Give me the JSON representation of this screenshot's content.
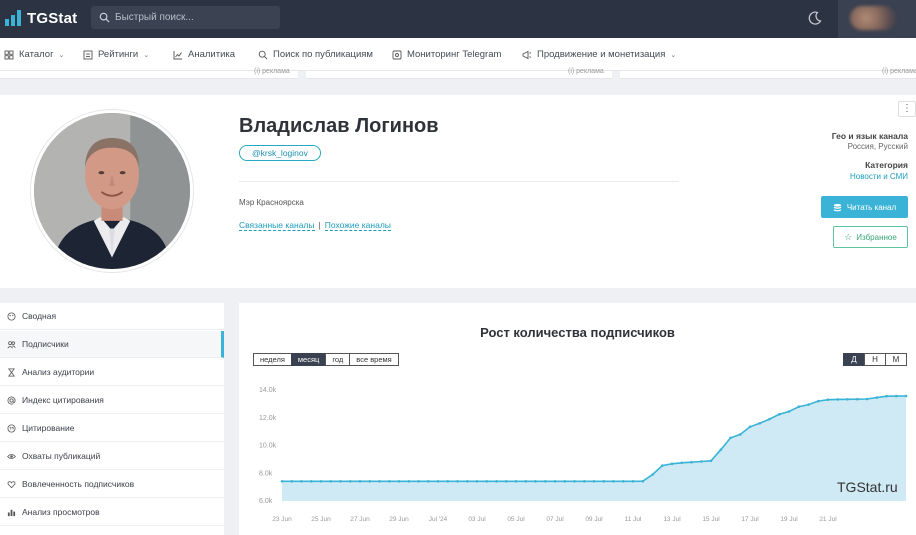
{
  "brand": {
    "name": "TGStat"
  },
  "search": {
    "placeholder": "Быстрый поиск..."
  },
  "menu": [
    {
      "label": "Каталог",
      "icon": "grid-icon",
      "dropdown": true
    },
    {
      "label": "Рейтинги",
      "icon": "list-icon",
      "dropdown": true
    },
    {
      "label": "Аналитика",
      "icon": "chart-line-icon",
      "dropdown": false
    },
    {
      "label": "Поиск по публикациям",
      "icon": "search-icon",
      "dropdown": false
    },
    {
      "label": "Мониторинг Telegram",
      "icon": "monitor-icon",
      "dropdown": false
    },
    {
      "label": "Продвижение и монетизация",
      "icon": "megaphone-icon",
      "dropdown": true
    }
  ],
  "strip": {
    "ad_label": "(i) реклама"
  },
  "profile": {
    "name": "Владислав Логинов",
    "handle": "@krsk_loginov",
    "description": "Мэр Красноярска",
    "related_link": "Связанные каналы",
    "similar_link": "Похожие каналы",
    "geo_title": "Гео и язык канала",
    "geo_value": "Россия, Русский",
    "category_title": "Категория",
    "category_value": "Новости и СМИ",
    "read_button": "Читать канал",
    "fav_button": "Избранное"
  },
  "sidebar": {
    "items": [
      {
        "label": "Сводная",
        "icon": "palette-icon",
        "active": false
      },
      {
        "label": "Подписчики",
        "icon": "users-icon",
        "active": true
      },
      {
        "label": "Анализ аудитории",
        "icon": "hourglass-icon",
        "active": false
      },
      {
        "label": "Индекс цитирования",
        "icon": "at-icon",
        "active": false
      },
      {
        "label": "Цитирование",
        "icon": "quote-icon",
        "active": false
      },
      {
        "label": "Охваты публикаций",
        "icon": "eye-icon",
        "active": false
      },
      {
        "label": "Вовлеченность подписчиков",
        "icon": "heart-icon",
        "active": false
      },
      {
        "label": "Анализ просмотров",
        "icon": "bar-chart-icon",
        "active": false
      }
    ]
  },
  "chart_panel": {
    "tabs": [
      "неделя",
      "месяц",
      "год",
      "все время"
    ],
    "selected_tab": "месяц",
    "period_tabs": [
      "Д",
      "Н",
      "М"
    ],
    "selected_period": "Д",
    "watermark": "TGStat.ru"
  },
  "chart_data": {
    "type": "area",
    "title": "Рост количества подписчиков",
    "y_ticks": [
      "6.0k",
      "8.0k",
      "10.0k",
      "12.0k",
      "14.0k"
    ],
    "ylim": [
      6000,
      14000
    ],
    "x_ticks": [
      "23 Jun",
      "25 Jun",
      "27 Jun",
      "29 Jun",
      "Jul '24",
      "03 Jul",
      "05 Jul",
      "07 Jul",
      "09 Jul",
      "11 Jul",
      "13 Jul",
      "15 Jul",
      "17 Jul",
      "19 Jul",
      "21 Jul"
    ],
    "x_start_label": "22 Jun",
    "series": [
      {
        "values": [
          7420,
          7420,
          7420,
          7420,
          7420,
          7420,
          7420,
          7420,
          7420,
          7420,
          7420,
          7420,
          7420,
          7420,
          7420,
          7420,
          7420,
          7420,
          7420,
          7420,
          7420,
          7420,
          7420,
          7420,
          7420,
          7420,
          7420,
          7420,
          7420,
          7420,
          7420,
          7420,
          7420,
          7420,
          7420,
          7420,
          7420,
          7430,
          7900,
          8550,
          8680,
          8750,
          8800,
          8850,
          8900,
          9700,
          10550,
          10800,
          11350,
          11600,
          11900,
          12250,
          12450,
          12800,
          12950,
          13200,
          13300,
          13320,
          13330,
          13340,
          13350,
          13450,
          13550,
          13560,
          13570
        ]
      }
    ],
    "grid": false,
    "area_color": "#cfeaf4",
    "line_color": "#3bb3d6"
  }
}
